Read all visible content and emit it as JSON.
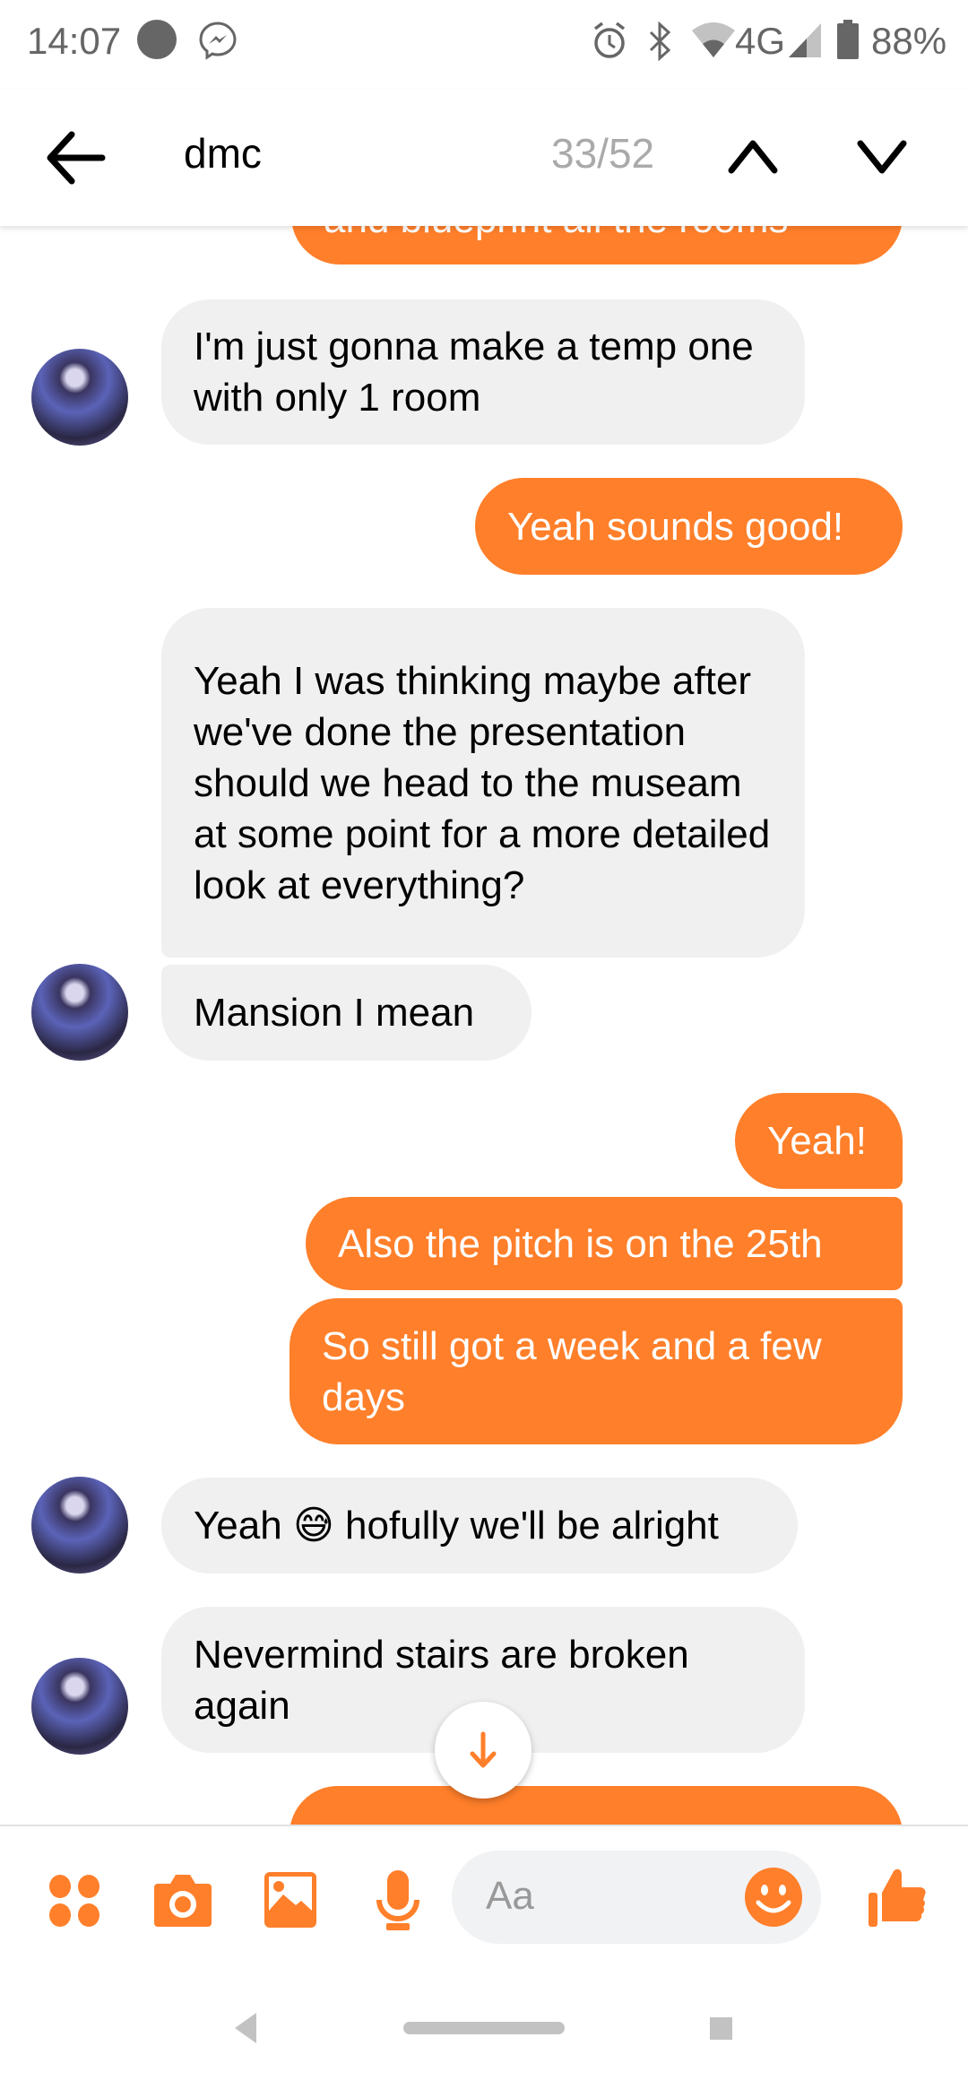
{
  "status_bar": {
    "time": "14:07",
    "network": "4G",
    "battery": "88%",
    "icons": [
      "dot-icon",
      "messenger-icon",
      "alarm-icon",
      "bluetooth-icon",
      "wifi-icon",
      "signal-icon",
      "battery-icon"
    ]
  },
  "header": {
    "search_query": "dmc",
    "result_counter": "33/52",
    "icons": [
      "back-arrow-icon",
      "chevron-up-icon",
      "chevron-down-icon"
    ]
  },
  "messages": [
    {
      "side": "out",
      "text": "and blueprint all the rooms"
    },
    {
      "side": "in",
      "text": "I'm just gonna make a temp one with only 1 room"
    },
    {
      "side": "out",
      "text": "Yeah sounds good!"
    },
    {
      "side": "in",
      "text": "Yeah I was thinking maybe after we've done the presentation should we head to the museam at some point for a more detailed look at everything?"
    },
    {
      "side": "in",
      "text": "Mansion I mean"
    },
    {
      "side": "out",
      "text": "Yeah!"
    },
    {
      "side": "out",
      "text": "Also the pitch is on the 25th"
    },
    {
      "side": "out",
      "text": "So still got a week and a few days"
    },
    {
      "side": "in",
      "text": "Yeah 😅 hofully we'll be alright"
    },
    {
      "side": "in",
      "text": "Nevermind stairs are broken again"
    }
  ],
  "composer": {
    "placeholder": "Aa",
    "icons": [
      "more-apps-icon",
      "camera-icon",
      "gallery-icon",
      "microphone-icon",
      "emoji-icon",
      "thumbs-up-icon"
    ]
  },
  "colors": {
    "accent": "#ff7f2a",
    "received_bubble": "#f0f0f0",
    "composer_input": "#f1f2f4"
  }
}
